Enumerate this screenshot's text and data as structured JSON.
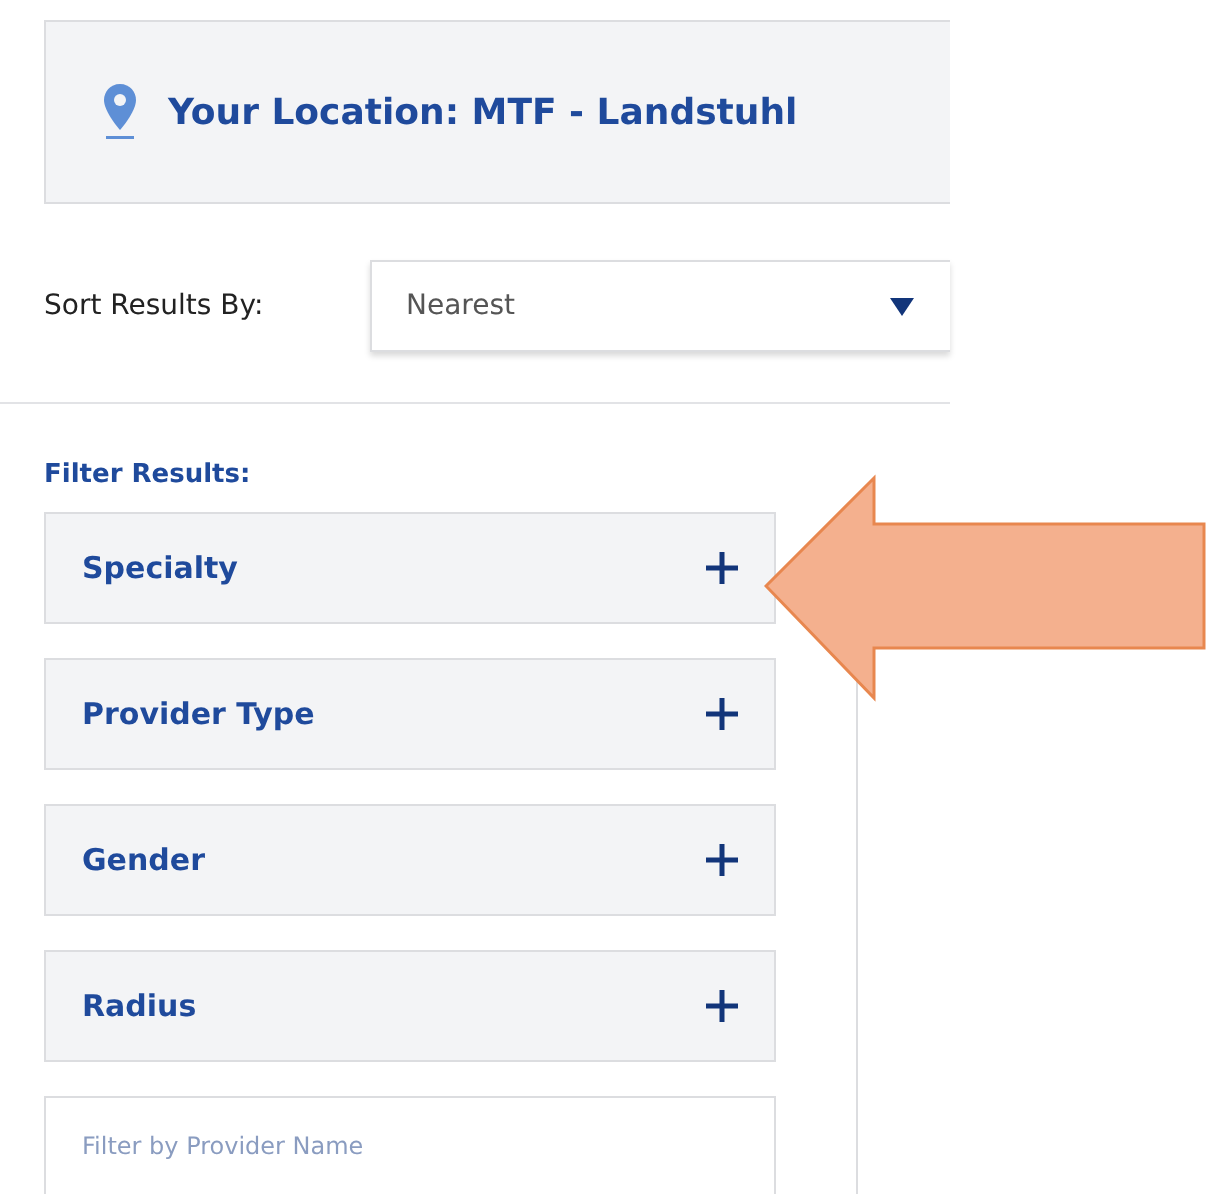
{
  "location": {
    "label": "Your Location: MTF - Landstuhl"
  },
  "sort": {
    "label": "Sort Results By:",
    "value": "Nearest"
  },
  "filters": {
    "title": "Filter Results:",
    "sections": [
      {
        "label": "Specialty",
        "expanded": false
      },
      {
        "label": "Provider Type",
        "expanded": false
      },
      {
        "label": "Gender",
        "expanded": false
      },
      {
        "label": "Radius",
        "expanded": false
      }
    ],
    "search": {
      "placeholder": "Filter by Provider Name"
    }
  },
  "callout": {
    "kind": "arrow",
    "color": "#f4b08e"
  }
}
